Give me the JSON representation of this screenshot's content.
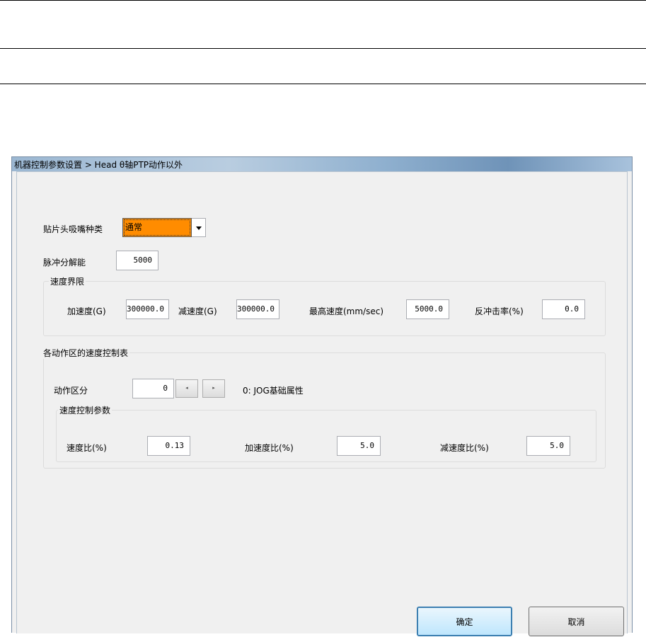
{
  "window": {
    "title": "机器控制参数设置 > Head θ轴PTP动作以外"
  },
  "nozzle": {
    "label": "贴片头吸嘴种类",
    "selected": "通常"
  },
  "pulse": {
    "label": "脉冲分解能",
    "value": "5000"
  },
  "speed_limits": {
    "legend": "速度界限",
    "accel_label": "加速度(G)",
    "accel_value": "300000.0",
    "decel_label": "减速度(G)",
    "decel_value": "300000.0",
    "max_speed_label": "最高速度(mm/sec)",
    "max_speed_value": "5000.0",
    "recoil_label": "反冲击率(%)",
    "recoil_value": "0.0"
  },
  "speed_table": {
    "legend": "各动作区的速度控制表",
    "zone_label": "动作区分",
    "zone_value": "0",
    "spin_left": "◂",
    "spin_right": "▸",
    "zone_desc": "0: JOG基础属性",
    "params": {
      "legend": "速度控制参数",
      "speed_ratio_label": "速度比(%)",
      "speed_ratio_value": "0.13",
      "accel_ratio_label": "加速度比(%)",
      "accel_ratio_value": "5.0",
      "decel_ratio_label": "减速度比(%)",
      "decel_ratio_value": "5.0"
    }
  },
  "buttons": {
    "ok": "确定",
    "cancel": "取消"
  }
}
